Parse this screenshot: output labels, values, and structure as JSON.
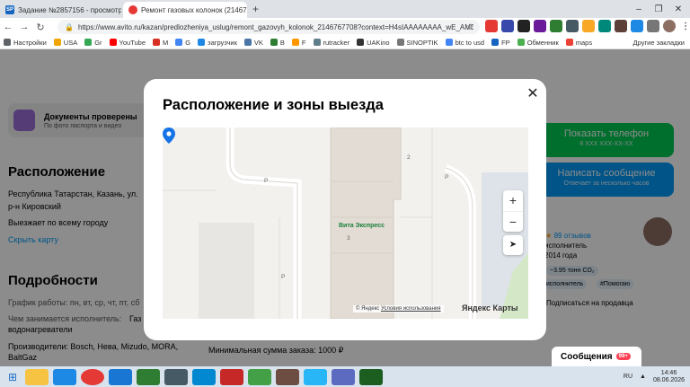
{
  "tabs": [
    {
      "label": "Задание №2857156 - просмотр з",
      "favicon": "SP",
      "active": false
    },
    {
      "label": "Ремонт газовых колонок (214676",
      "favicon": "avito",
      "active": true
    }
  ],
  "address_bar": {
    "url": "https://www.avito.ru/kazan/predlozheniya_uslug/remont_gazovyh_kolonok_2146767708?context=H4sIAAAAAAAA_wE_AMD_Y..."
  },
  "bookmarks": [
    {
      "label": "Настройки",
      "color": "#5f6368"
    },
    {
      "label": "USA",
      "color": "#f0a500"
    },
    {
      "label": "Gr",
      "color": "#34a853"
    },
    {
      "label": "YouTube",
      "color": "#ff0000"
    },
    {
      "label": "M",
      "color": "#d93025"
    },
    {
      "label": "G",
      "color": "#4285f4"
    },
    {
      "label": "загрузчик",
      "color": "#1e88e5"
    },
    {
      "label": "VK",
      "color": "#4a76a8"
    },
    {
      "label": "B",
      "color": "#2e7d32"
    },
    {
      "label": "F",
      "color": "#ff9800"
    },
    {
      "label": "rutracker",
      "color": "#607d8b"
    },
    {
      "label": "UAKino",
      "color": "#333333"
    },
    {
      "label": "SINOPTIK",
      "color": "#777777"
    },
    {
      "label": "btc to usd",
      "color": "#4285f4"
    },
    {
      "label": "FP",
      "color": "#1565c0"
    },
    {
      "label": "Обменник",
      "color": "#4caf50"
    },
    {
      "label": "maps",
      "color": "#ea4335"
    }
  ],
  "bookmarks_other": "Другие закладки",
  "page": {
    "verified_title": "Документы проверены",
    "verified_sub": "По фото паспорта и видео",
    "location_heading": "Расположение",
    "location_addr1": "Республика Татарстан, Казань, ул.",
    "location_addr2": "р-н Кировский",
    "location_travel": "Выезжает по всему городу",
    "show_map_link": "Скрыть карту",
    "details_heading": "Подробности",
    "schedule": "График работы: пн, вт, ср, чт, пт, сб",
    "occupation_label": "Чем занимается исполнитель:",
    "occupation_value": "Газ",
    "occupation_value2": "водонагреватели",
    "brands": "Производители: Bosch, Нева, Mizudo, MORA,",
    "brands2": "BaltGaz",
    "min_order": "Минимальная сумма заказа: 1000 ₽",
    "show_phone": "Показать телефон",
    "show_phone_sub": "8 XXX XXX-XX-XX",
    "write_msg": "Написать сообщение",
    "write_msg_sub": "Отвечает за несколько часов",
    "reviews": "89 отзывов",
    "seller_type": "исполнитель",
    "since": "2014 года",
    "co2": "~3.95 тонн CO₂",
    "tag1": "исполнитель",
    "tag2": "#Помогаю",
    "delivery": "Подписаться на продавца"
  },
  "modal": {
    "title": "Расположение и зоны выезда",
    "pin_label": "Вита Экспресс",
    "map_labels": [
      "P",
      "P",
      "P",
      "2",
      "3"
    ],
    "copyright": "© Яндекс",
    "terms_link": "Условия использования",
    "yandex_logo": "Яндекс Карты"
  },
  "messages": {
    "label": "Сообщения",
    "badge": "99+"
  },
  "taskbar": {
    "lang": "RU",
    "time": "14:46",
    "date": "08.06.2026"
  },
  "colors": {
    "green": "#00c853",
    "blue": "#0099f7",
    "purple": "#9b6dd7",
    "pin_blue": "#1473e6"
  }
}
